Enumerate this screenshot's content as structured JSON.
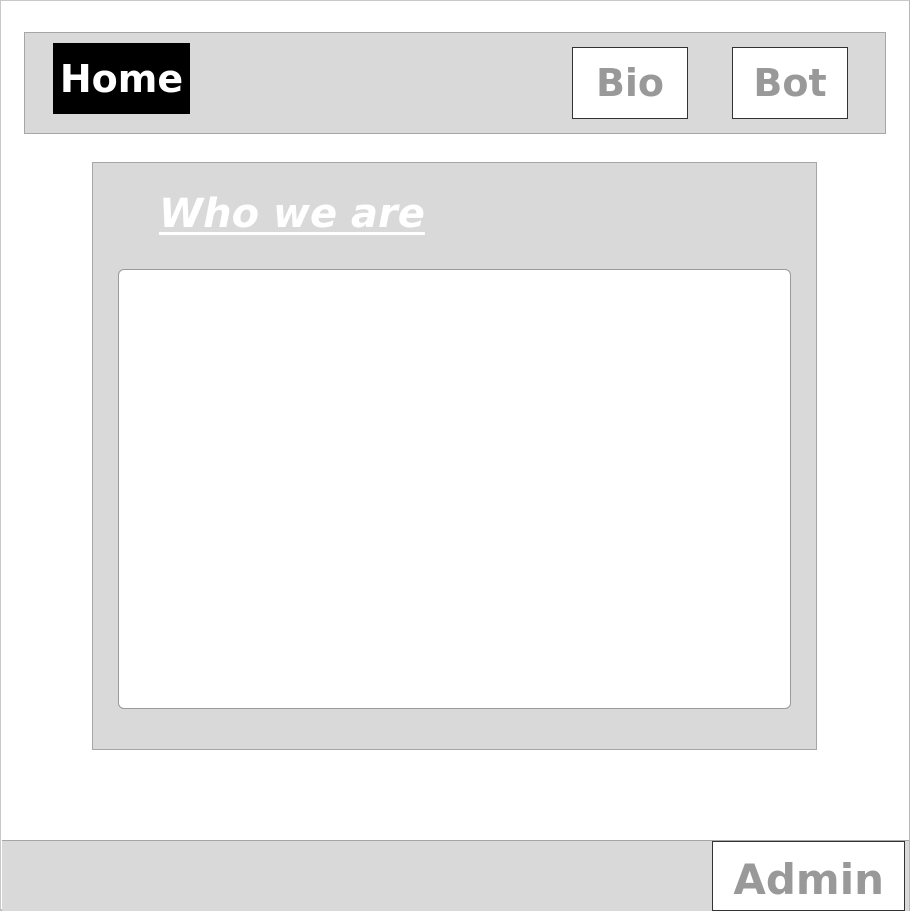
{
  "nav": {
    "home_label": "Home",
    "bio_label": "Bio",
    "bot_label": "Bot"
  },
  "main": {
    "section_title": "Who we are",
    "content_text": ""
  },
  "footer": {
    "admin_label": "Admin"
  },
  "colors": {
    "background": "#ffffff",
    "bar_gray": "#d9d9d9",
    "active_button": "#000000",
    "inactive_text": "#999999"
  }
}
